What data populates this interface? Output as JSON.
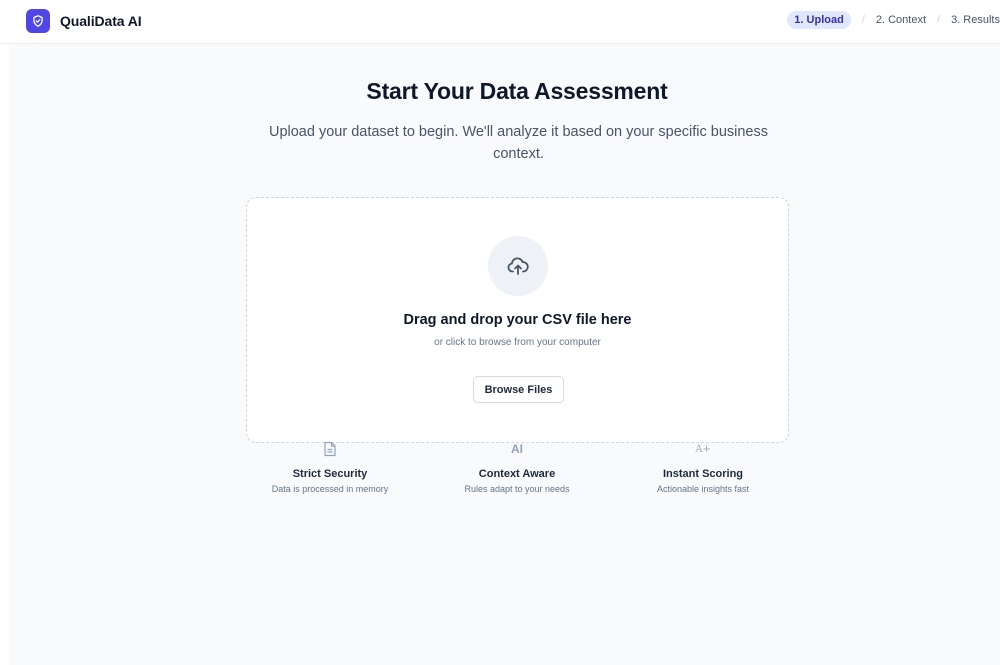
{
  "app": {
    "name": "QualiData AI",
    "colors": {
      "brand": "#4f46e5",
      "active_step_bg": "#e0e7ff",
      "active_step_text": "#3730a3"
    }
  },
  "steps": [
    {
      "label": "1. Upload",
      "active": true
    },
    {
      "label": "2. Context",
      "active": false
    },
    {
      "label": "3. Results",
      "active": false
    }
  ],
  "step_separator": "/",
  "hero": {
    "title": "Start Your Data Assessment",
    "subtitle": "Upload your dataset to begin. We'll analyze it based on your specific business context."
  },
  "dropzone": {
    "icon": "cloud-upload-icon",
    "title": "Drag and drop your CSV file here",
    "subtitle": "or click to browse from your computer",
    "browse_label": "Browse Files"
  },
  "features": [
    {
      "icon": "document-icon",
      "title": "Strict Security",
      "description": "Data is processed in memory"
    },
    {
      "icon": "ai-icon",
      "icon_text": "AI",
      "title": "Context Aware",
      "description": "Rules adapt to your needs"
    },
    {
      "icon": "grade-icon",
      "icon_text": "A+",
      "title": "Instant Scoring",
      "description": "Actionable insights fast"
    }
  ]
}
